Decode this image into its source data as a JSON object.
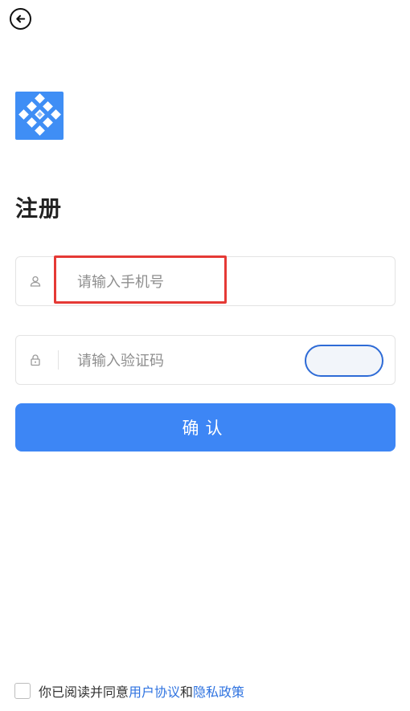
{
  "header": {
    "back_icon": "arrow-left-circle-icon"
  },
  "brand": {
    "logo_icon": "diamond-grid-logo",
    "color": "#3f8ef5"
  },
  "page_title": "注册",
  "phone_field": {
    "icon": "user-icon",
    "placeholder": "请输入手机号",
    "value": ""
  },
  "code_field": {
    "icon": "lock-icon",
    "placeholder": "请输入验证码",
    "value": ""
  },
  "confirm_button": {
    "label": "确认",
    "color": "#3d86f5"
  },
  "agreement": {
    "prefix": "你已阅读并同意",
    "user_agreement": "用户协议",
    "conjunction": "和",
    "privacy_policy": "隐私政策",
    "checked": false,
    "link_color": "#2f73e0"
  },
  "highlight_color": "#e53935"
}
